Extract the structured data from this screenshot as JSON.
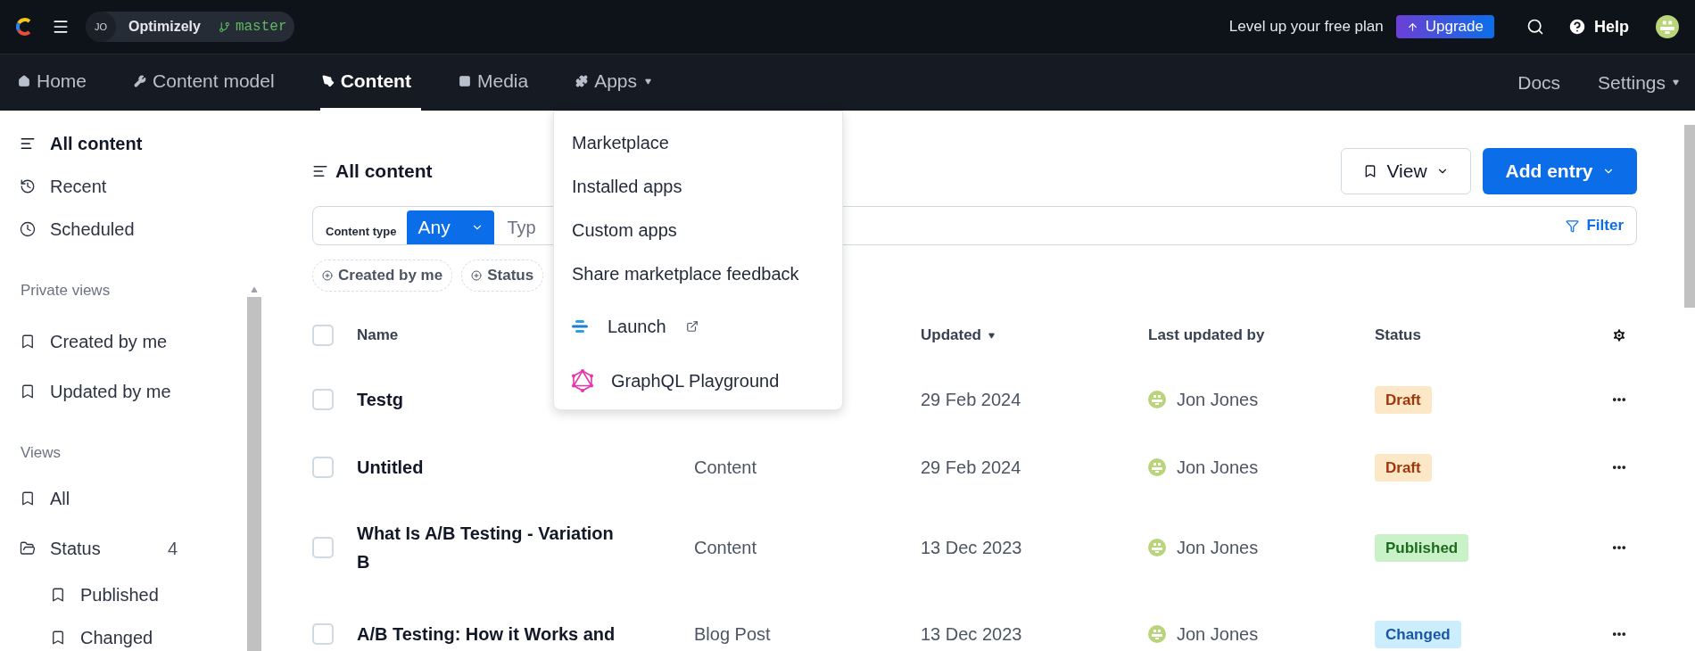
{
  "topbar": {
    "org_initials": "JO",
    "org": "Optimizely",
    "branch": "master",
    "promo": "Level up your free plan",
    "upgrade": "Upgrade",
    "help": "Help"
  },
  "nav": {
    "items": [
      {
        "label": "Home",
        "kind": "home",
        "selected": false,
        "caret": false
      },
      {
        "label": "Content model",
        "kind": "model",
        "selected": false,
        "caret": false
      },
      {
        "label": "Content",
        "kind": "content",
        "selected": true,
        "caret": false
      },
      {
        "label": "Media",
        "kind": "media",
        "selected": false,
        "caret": false
      },
      {
        "label": "Apps",
        "kind": "apps",
        "selected": false,
        "caret": true
      }
    ],
    "right": [
      {
        "label": "Docs",
        "caret": false
      },
      {
        "label": "Settings",
        "caret": true
      }
    ]
  },
  "sidebar": {
    "items": [
      {
        "label": "All content",
        "kind": "all",
        "selected": true
      },
      {
        "label": "Recent",
        "kind": "recent",
        "selected": false
      },
      {
        "label": "Scheduled",
        "kind": "scheduled",
        "selected": false
      }
    ],
    "sections": [
      {
        "title": "Private views",
        "items": [
          {
            "label": "Created by me",
            "kind": "view"
          },
          {
            "label": "Updated by me",
            "kind": "view"
          }
        ]
      },
      {
        "title": "Views",
        "items": [
          {
            "label": "All",
            "kind": "view"
          },
          {
            "label": "Status",
            "kind": "folder",
            "count": "4",
            "children": [
              {
                "label": "Published",
                "kind": "view"
              },
              {
                "label": "Changed",
                "kind": "view"
              }
            ]
          }
        ]
      }
    ]
  },
  "main": {
    "title": "All content",
    "view_button": "View",
    "add_button": "Add entry",
    "search": {
      "label": "Content type",
      "value": "Any",
      "placeholder": "Typ",
      "filter": "Filter"
    },
    "chips": [
      "Created by me",
      "Status"
    ]
  },
  "table": {
    "all_checked": false,
    "columns": [
      {
        "label": "Name",
        "sorted": false
      },
      {
        "label": "Updated",
        "sorted": true
      },
      {
        "label": "Last updated by",
        "sorted": false
      },
      {
        "label": "Status",
        "sorted": false
      }
    ],
    "rows": [
      {
        "checked": false,
        "name": "Testg",
        "updated": "29 Feb 2024",
        "author": "Jon Jones",
        "status": {
          "label": "Draft",
          "kind": "draft"
        }
      },
      {
        "checked": false,
        "name": "Untitled",
        "type": "Content",
        "updated": "29 Feb 2024",
        "author": "Jon Jones",
        "status": {
          "label": "Draft",
          "kind": "draft"
        }
      },
      {
        "checked": false,
        "name": "What Is A/B Testing - Variation B",
        "type": "Content",
        "updated": "13 Dec 2023",
        "author": "Jon Jones",
        "status": {
          "label": "Published",
          "kind": "published"
        }
      },
      {
        "checked": false,
        "name": "A/B Testing: How it Works and",
        "type": "Blog Post",
        "updated": "13 Dec 2023",
        "author": "Jon Jones",
        "status": {
          "label": "Changed",
          "kind": "changed"
        }
      }
    ]
  },
  "apps_menu": {
    "items": [
      "Marketplace",
      "Installed apps",
      "Custom apps",
      "Share marketplace feedback"
    ],
    "apps": [
      {
        "label": "Launch",
        "kind": "launch",
        "external": true
      },
      {
        "label": "GraphQL Playground",
        "kind": "graphql",
        "external": false
      }
    ]
  }
}
